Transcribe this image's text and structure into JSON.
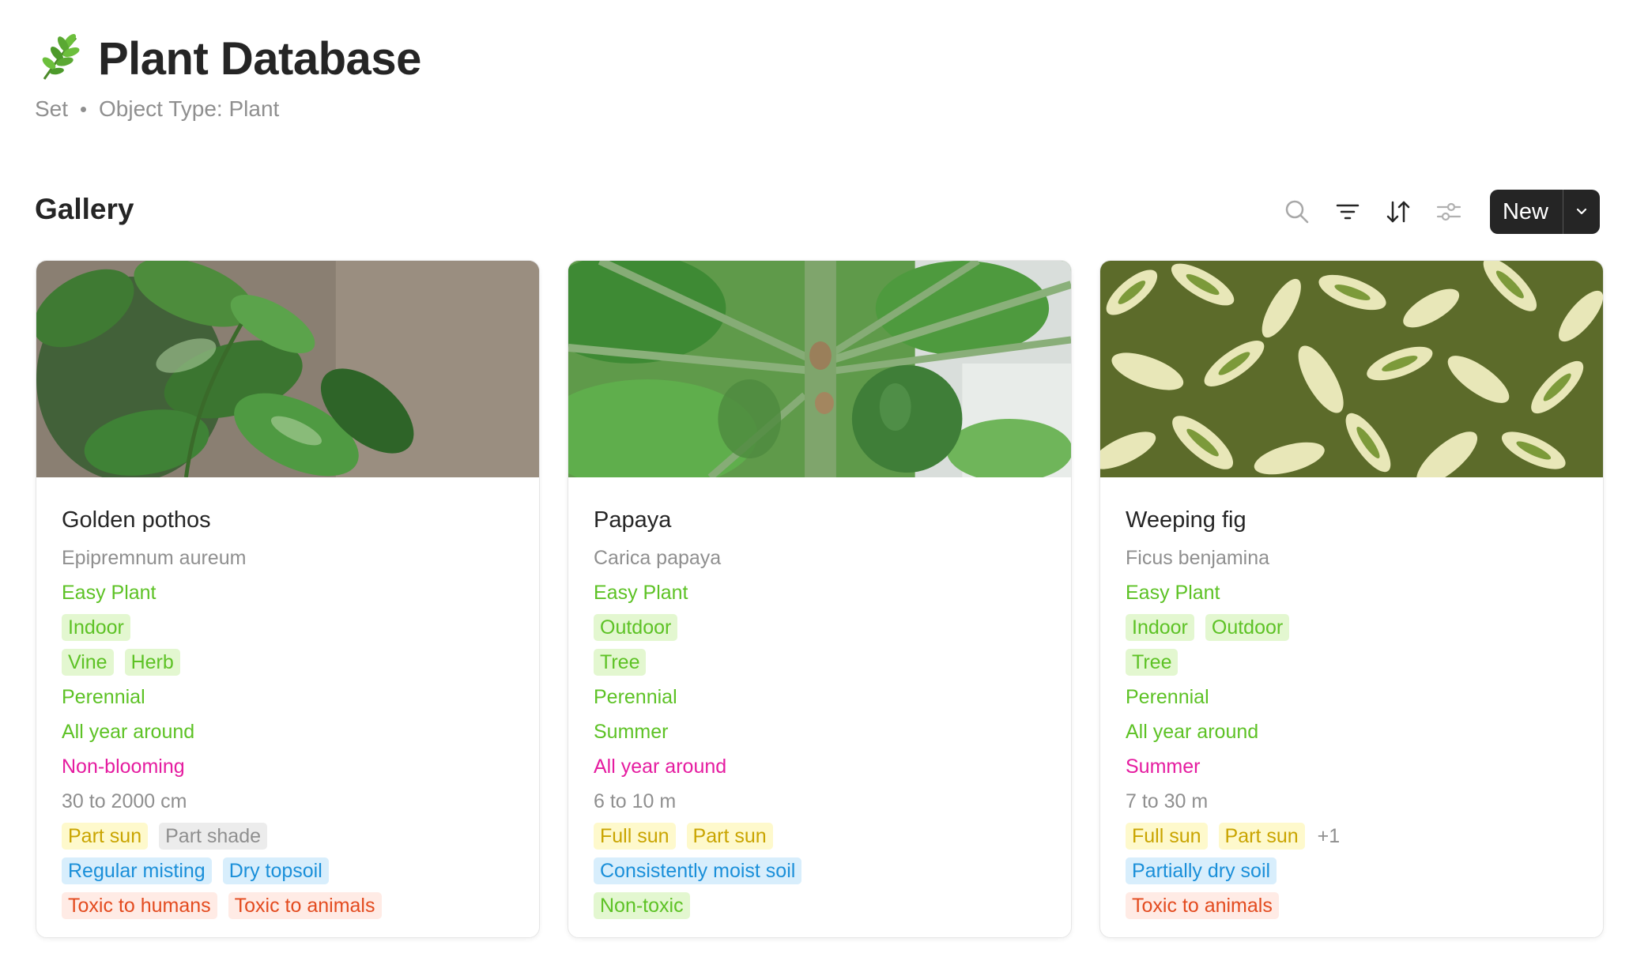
{
  "header": {
    "title": "Plant Database",
    "subtitle_type": "Set",
    "subtitle_object": "Object Type: Plant",
    "icon": "herb-icon"
  },
  "gallery": {
    "label": "Gallery",
    "toolbar": {
      "search_icon": "search-icon",
      "filter_icon": "filter-icon",
      "sort_icon": "sort-icon",
      "settings_icon": "settings-icon",
      "new_label": "New"
    }
  },
  "colors": {
    "green": "#5dc225",
    "magenta": "#e51ca0",
    "yellow_tag": "#fef9cc",
    "blue_tag": "#d8eefc",
    "red_tag": "#ffebe5"
  },
  "cards": [
    {
      "name": "Golden pothos",
      "latin": "Epipremnum aureum",
      "difficulty": "Easy Plant",
      "location_tags": [
        "Indoor"
      ],
      "type_tags": [
        "Vine",
        "Herb"
      ],
      "lifecycle": "Perennial",
      "growing": "All year around",
      "blooming": "Non-blooming",
      "size": "30 to 2000 cm",
      "light_tags": [
        "Part sun",
        "Part shade"
      ],
      "watering_tags": [
        "Regular misting",
        "Dry topsoil"
      ],
      "toxicity_tags": [
        "Toxic to humans",
        "Toxic to animals"
      ]
    },
    {
      "name": "Papaya",
      "latin": "Carica papaya",
      "difficulty": "Easy Plant",
      "location_tags": [
        "Outdoor"
      ],
      "type_tags": [
        "Tree"
      ],
      "lifecycle": "Perennial",
      "growing": "Summer",
      "blooming": "All year around",
      "size": "6 to 10 m",
      "light_tags": [
        "Full sun",
        "Part sun"
      ],
      "watering_tags": [
        "Consistently moist soil"
      ],
      "toxicity_tags": [
        "Non-toxic"
      ]
    },
    {
      "name": "Weeping fig",
      "latin": "Ficus benjamina",
      "difficulty": "Easy Plant",
      "location_tags": [
        "Indoor",
        "Outdoor"
      ],
      "type_tags": [
        "Tree"
      ],
      "lifecycle": "Perennial",
      "growing": "All year around",
      "blooming": "Summer",
      "size": "7 to 30 m",
      "light_tags": [
        "Full sun",
        "Part sun"
      ],
      "light_more": "+1",
      "watering_tags": [
        "Partially dry soil"
      ],
      "toxicity_tags": [
        "Toxic to animals"
      ]
    }
  ]
}
